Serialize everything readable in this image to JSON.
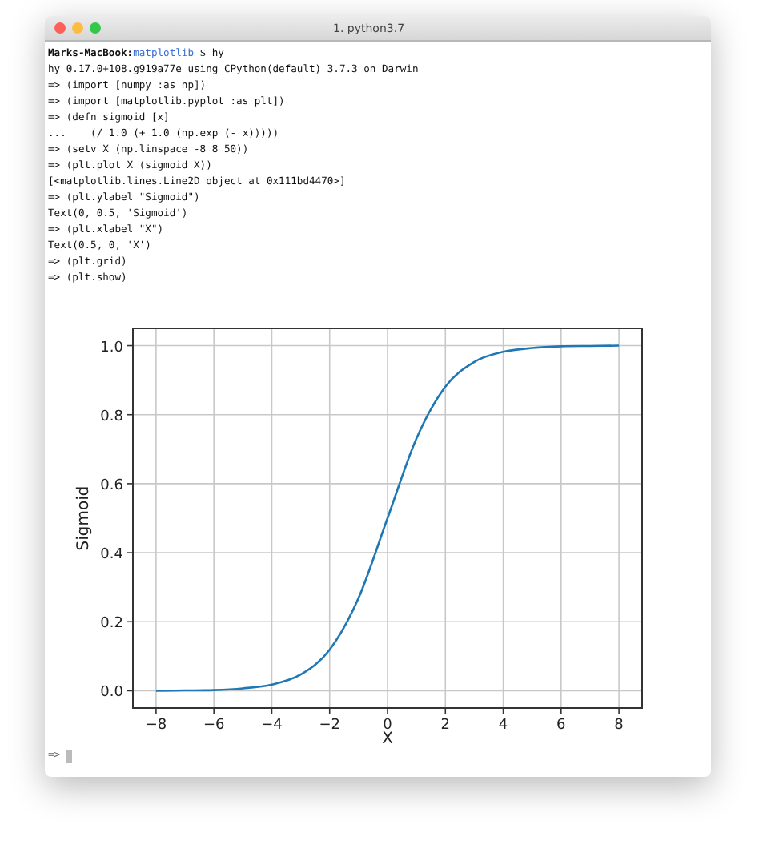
{
  "window": {
    "title": "1. python3.7"
  },
  "terminal": {
    "prompt": {
      "host": "Marks-MacBook:",
      "dir": "matplotlib",
      "command": " $ hy"
    },
    "lines": [
      "hy 0.17.0+108.g919a77e using CPython(default) 3.7.3 on Darwin",
      "=> (import [numpy :as np])",
      "=> (import [matplotlib.pyplot :as plt])",
      "=> (defn sigmoid [x]",
      "...    (/ 1.0 (+ 1.0 (np.exp (- x)))))",
      "=> (setv X (np.linspace -8 8 50))",
      "=> (plt.plot X (sigmoid X))",
      "[<matplotlib.lines.Line2D object at 0x111bd4470>]",
      "=> (plt.ylabel \"Sigmoid\")",
      "Text(0, 0.5, 'Sigmoid')",
      "=> (plt.xlabel \"X\")",
      "Text(0.5, 0, 'X')",
      "=> (plt.grid)",
      "=> (plt.show)"
    ],
    "input_prompt": "=>"
  },
  "chart_data": {
    "type": "line",
    "xlabel": "X",
    "ylabel": "Sigmoid",
    "x": [
      -8,
      -7,
      -6,
      -5,
      -4,
      -3,
      -2,
      -1,
      0,
      1,
      2,
      3,
      4,
      5,
      6,
      7,
      8
    ],
    "grid": true,
    "series": [
      {
        "color": "#1f77b4",
        "values": [
          0,
          0.001,
          0.002,
          0.007,
          0.018,
          0.047,
          0.119,
          0.269,
          0.5,
          0.731,
          0.881,
          0.953,
          0.982,
          0.993,
          0.998,
          0.999,
          1
        ]
      }
    ],
    "xlim": [
      -8.8,
      8.8
    ],
    "ylim": [
      -0.05,
      1.05
    ],
    "xticks": [
      {
        "value": -8,
        "label": "−8"
      },
      {
        "value": -6,
        "label": "−6"
      },
      {
        "value": -4,
        "label": "−4"
      },
      {
        "value": -2,
        "label": "−2"
      },
      0,
      2,
      4,
      6,
      8
    ],
    "yticks": [
      {
        "value": 0,
        "label": "0.0"
      },
      {
        "value": 0.2,
        "label": "0.2"
      },
      {
        "value": 0.4,
        "label": "0.4"
      },
      {
        "value": 0.6,
        "label": "0.6"
      },
      {
        "value": 0.8,
        "label": "0.8"
      },
      {
        "value": 1,
        "label": "1.0"
      }
    ]
  }
}
